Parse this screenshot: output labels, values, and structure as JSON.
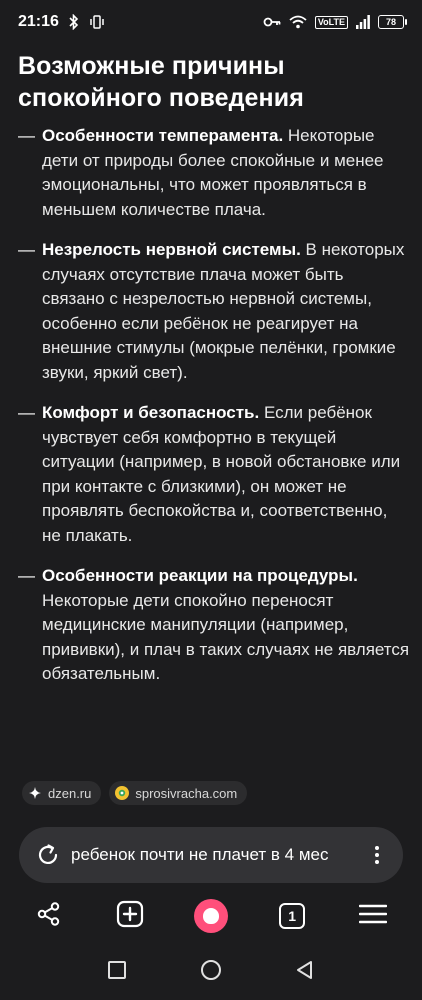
{
  "status_bar": {
    "time": "21:16",
    "network": "VoLTE",
    "battery": "78"
  },
  "article": {
    "title": "Возможные причины спокойного поведения",
    "items": [
      {
        "bold": "Особенности темперамента.",
        "text": " Некоторые дети от природы более спокойные и менее эмоциональны, что может проявляться в меньшем количестве плача."
      },
      {
        "bold": "Незрелость нервной системы.",
        "text": " В некоторых случаях отсутствие плача может быть связано с незрелостью нервной системы, особенно если ребёнок не реагирует на внешние стимулы (мокрые пелёнки, громкие звуки, яркий свет)."
      },
      {
        "bold": "Комфорт и безопасность.",
        "text": " Если ребёнок чувствует себя комфортно в текущей ситуации (например, в новой обстановке или при контакте с близкими), он может не проявлять беспокойства и, соответственно, не плакать."
      },
      {
        "bold": "Особенности реакции на процедуры.",
        "text": " Некоторые дети спокойно переносят медицинские манипуляции (например, прививки), и плач в таких случаях не является обязательным."
      }
    ],
    "dash": "—"
  },
  "sources": [
    {
      "label": "dzen.ru",
      "icon": "dzen-icon"
    },
    {
      "label": "sprosivracha.com",
      "icon": "sprosivracha-icon"
    }
  ],
  "query": {
    "text": "ребенок почти не плачет в 4 мес"
  },
  "toolbar": {
    "tab_count": "1",
    "alice_color": "#ff4f7b"
  }
}
